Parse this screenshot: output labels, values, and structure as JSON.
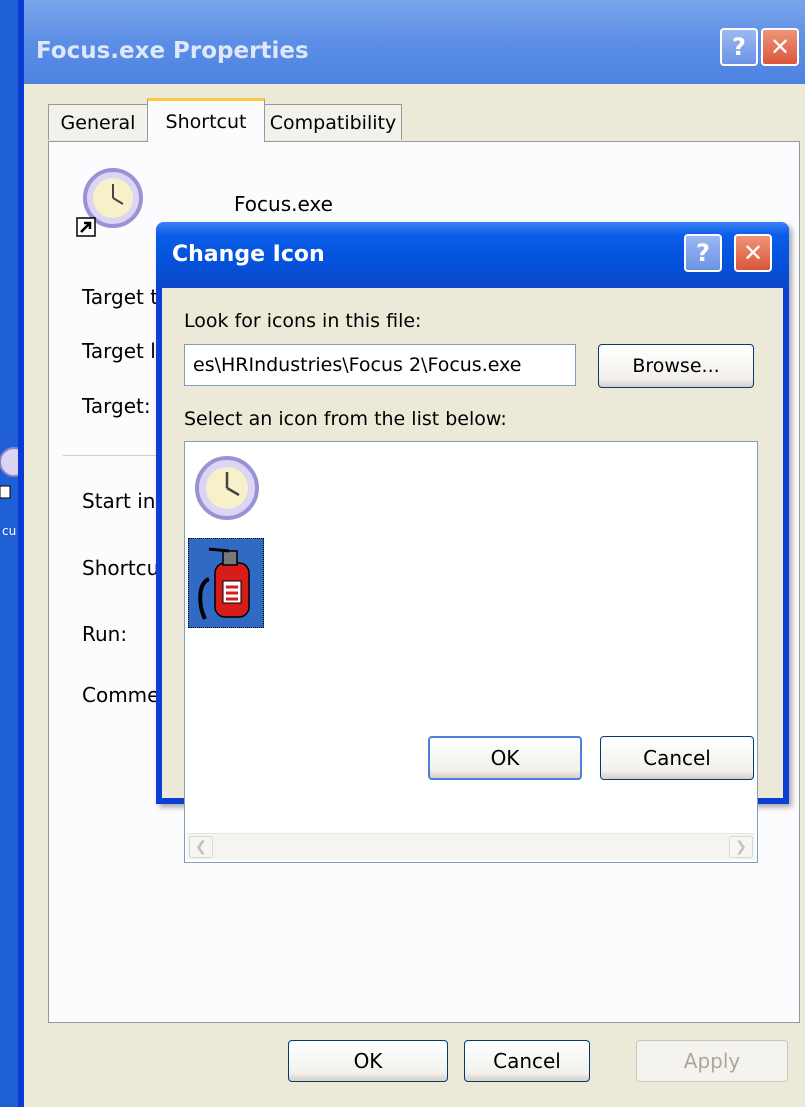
{
  "outer_window": {
    "title": "Focus.exe Properties",
    "help_label": "?",
    "close_label": "✕",
    "tabs": [
      {
        "label": "General"
      },
      {
        "label": "Shortcut",
        "active": true
      },
      {
        "label": "Compatibility"
      }
    ],
    "shortcut_name": "Focus.exe",
    "labels": {
      "target_type": "Target ty",
      "target_location": "Target lo",
      "target": "Target:",
      "start_in": "Start in:",
      "shortcut_key": "Shortcu",
      "run": "Run:",
      "comment": "Commen"
    },
    "buttons": {
      "ok": "OK",
      "cancel": "Cancel",
      "apply": "Apply"
    }
  },
  "desktop": {
    "icon_label": "cu"
  },
  "change_icon_dialog": {
    "title": "Change Icon",
    "help_label": "?",
    "close_label": "✕",
    "look_for_label": "Look for icons in this file:",
    "file_path": "es\\HRIndustries\\Focus 2\\Focus.exe",
    "browse_label": "Browse...",
    "select_label": "Select an icon from the list below:",
    "icons": [
      {
        "name": "clock-icon",
        "selected": false
      },
      {
        "name": "fire-extinguisher-icon",
        "selected": true
      }
    ],
    "ok_label": "OK",
    "cancel_label": "Cancel"
  },
  "colors": {
    "title_bar": "#0552dc",
    "window_bg": "#ece9d8",
    "selection": "#316ac5"
  }
}
